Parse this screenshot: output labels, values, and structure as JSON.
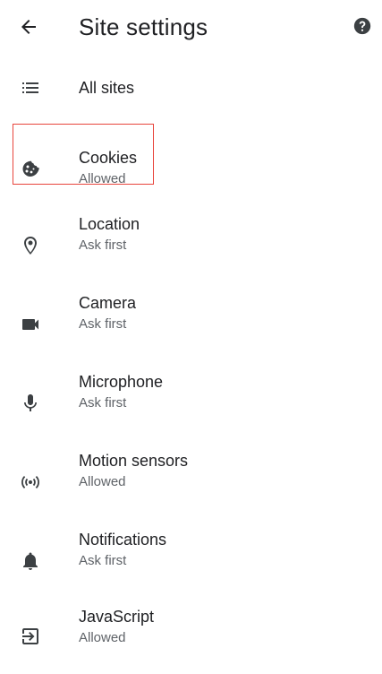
{
  "appbar": {
    "back_icon": "arrow-back-icon",
    "title": "Site settings",
    "help_icon": "help-icon"
  },
  "items": [
    {
      "label": "All sites",
      "sub": "",
      "icon": "list-icon"
    },
    {
      "label": "Cookies",
      "sub": "Allowed",
      "icon": "cookie-icon"
    },
    {
      "label": "Location",
      "sub": "Ask first",
      "icon": "location-pin-icon"
    },
    {
      "label": "Camera",
      "sub": "Ask first",
      "icon": "videocam-icon"
    },
    {
      "label": "Microphone",
      "sub": "Ask first",
      "icon": "mic-icon"
    },
    {
      "label": "Motion sensors",
      "sub": "Allowed",
      "icon": "sensors-icon"
    },
    {
      "label": "Notifications",
      "sub": "Ask first",
      "icon": "bell-icon"
    },
    {
      "label": "JavaScript",
      "sub": "Allowed",
      "icon": "javascript-icon"
    }
  ],
  "colors": {
    "text_primary": "#202124",
    "text_secondary": "#5f6368",
    "highlight_border": "#e8453c"
  }
}
